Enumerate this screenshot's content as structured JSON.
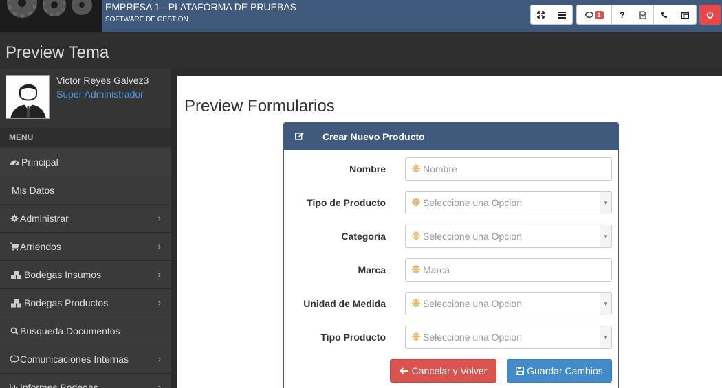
{
  "topbar": {
    "company_title": "EMPRESA 1 - PLATAFORMA DE PRUEBAS",
    "company_subtitle": "SOFTWARE DE GESTION",
    "buttons": {
      "fullscreen_icon": "expand-icon",
      "menu_icon": "bars-icon",
      "chat_icon": "comment-icon",
      "chat_badge": "2",
      "help_label": "?",
      "document_icon": "file-word-icon",
      "phone_icon": "phone-icon",
      "calendar_icon": "calendar-icon",
      "power_icon": "power-off-icon"
    }
  },
  "page_header": {
    "title": "Preview Tema"
  },
  "sidebar": {
    "user_name": "Victor Reyes Galvez3",
    "user_role": "Super Administrador",
    "menu_header": "MENU",
    "items": [
      {
        "label": "Principal",
        "icon": "dashboard-icon",
        "has_submenu": false
      },
      {
        "label": "Mis Datos",
        "icon": "",
        "has_submenu": false
      },
      {
        "label": "Administrar",
        "icon": "gear-icon",
        "has_submenu": true
      },
      {
        "label": "Arriendos",
        "icon": "cart-icon",
        "has_submenu": true
      },
      {
        "label": "Bodegas Insumos",
        "icon": "cubes-icon",
        "has_submenu": true
      },
      {
        "label": "Bodegas Productos",
        "icon": "cubes-icon",
        "has_submenu": true
      },
      {
        "label": "Busqueda Documentos",
        "icon": "search-icon",
        "has_submenu": false
      },
      {
        "label": "Comunicaciones Internas",
        "icon": "comment-icon",
        "has_submenu": true
      },
      {
        "label": "Informes Bodegas",
        "icon": "bar-chart-icon",
        "has_submenu": true
      }
    ]
  },
  "main": {
    "title": "Preview Formularios",
    "panel": {
      "title": "Crear Nuevo Producto",
      "fields": [
        {
          "label": "Nombre",
          "placeholder": "Nombre",
          "type": "text"
        },
        {
          "label": "Tipo de Producto",
          "placeholder": "Seleccione una Opcion",
          "type": "select"
        },
        {
          "label": "Categoria",
          "placeholder": "Seleccione una Opcion",
          "type": "select"
        },
        {
          "label": "Marca",
          "placeholder": "Marca",
          "type": "text"
        },
        {
          "label": "Unidad de Medida",
          "placeholder": "Seleccione una Opcion",
          "type": "select"
        },
        {
          "label": "Tipo Producto",
          "placeholder": "Seleccione una Opcion",
          "type": "select"
        }
      ],
      "cancel_label": "Cancelar y Volver",
      "save_label": "Guardar Cambios"
    }
  },
  "colors": {
    "topbar": "#3f5a7d",
    "sidebar": "#383838",
    "accent_red": "#d9534f",
    "accent_blue": "#428bca",
    "role_link": "#4a9be6",
    "required_asterisk": "#f0ad4e"
  }
}
